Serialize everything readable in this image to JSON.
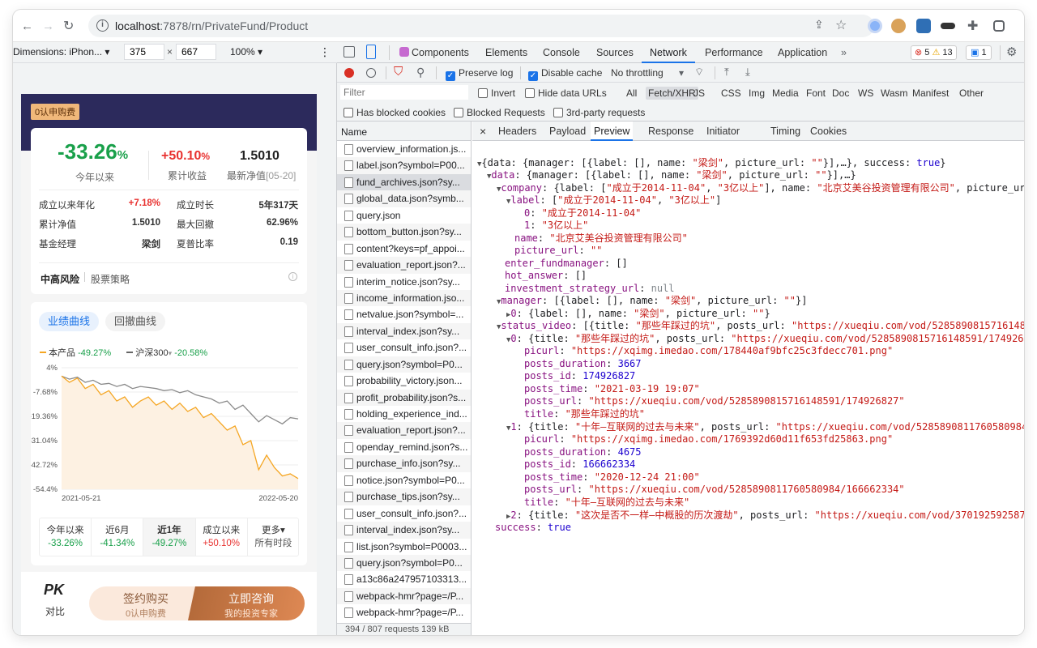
{
  "browser": {
    "url_host": "localhost",
    "url_rest": ":7878/rn/PrivateFund/Product"
  },
  "device_toolbar": {
    "dimensions_label": "Dimensions: iPhon...",
    "width": "375",
    "height": "667",
    "zoom": "100%"
  },
  "app": {
    "badge": "0认申购费",
    "summary": {
      "main_value": "-33.26",
      "main_unit": "%",
      "main_label": "今年以来",
      "cum_value": "+50.10",
      "cum_unit": "%",
      "cum_label": "累计收益",
      "nav_value": "1.5010",
      "nav_label": "最新净值",
      "nav_date": "[05-20]"
    },
    "stats": [
      {
        "label": "成立以来年化",
        "value": "+7.18%"
      },
      {
        "label": "成立时长",
        "value": "5年317天"
      },
      {
        "label": "累计净值",
        "value": "1.5010"
      },
      {
        "label": "最大回撤",
        "value": "62.96%"
      },
      {
        "label": "基金经理",
        "value": "梁剑"
      },
      {
        "label": "夏普比率",
        "value": "0.19"
      }
    ],
    "risk": "中高风险",
    "strategy": "股票策略",
    "chart_tabs": [
      "业绩曲线",
      "回撤曲线"
    ],
    "legend": {
      "product_name": "本产品",
      "product_value": "-49.27%",
      "index_name": "沪深300",
      "index_value": "-20.58%"
    },
    "periods": [
      {
        "name": "今年以来",
        "value": "-33.26%"
      },
      {
        "name": "近6月",
        "value": "-41.34%"
      },
      {
        "name": "近1年",
        "value": "-49.27%"
      },
      {
        "name": "成立以来",
        "value": "+50.10%"
      },
      {
        "name": "更多▾",
        "value": "所有时段"
      }
    ],
    "pk": {
      "title": "PK",
      "label": "对比"
    },
    "buy": {
      "title": "签约购买",
      "sub": "0认申购费"
    },
    "consult": {
      "title": "立即咨询",
      "sub": "我的投资专家"
    }
  },
  "chart_data": {
    "type": "line",
    "y_ticks": [
      "4%",
      "-7.68%",
      "-19.36%",
      "-31.04%",
      "-42.72%",
      "-54.4%"
    ],
    "ylim": [
      -54.4,
      4
    ],
    "x_ticks": [
      "2021-05-21",
      "2022-05-20"
    ],
    "series": [
      {
        "name": "本产品",
        "color": "#f5a623",
        "values": [
          0,
          -3,
          -1,
          -6,
          -4,
          -9,
          -7,
          -12,
          -10,
          -15,
          -12,
          -10,
          -14,
          -12,
          -16,
          -13,
          -17,
          -15,
          -20,
          -18,
          -22,
          -26,
          -24,
          -33,
          -31,
          -45,
          -38,
          -44,
          -48,
          -47,
          -49.27
        ]
      },
      {
        "name": "沪深300",
        "color": "#8a8a8a",
        "values": [
          0,
          -1.5,
          -0.5,
          -3,
          -2,
          -4,
          -3.5,
          -5,
          -4,
          -6,
          -5,
          -5.5,
          -6,
          -7,
          -6.5,
          -8,
          -7,
          -9,
          -10,
          -11,
          -13,
          -12,
          -16,
          -14,
          -18,
          -22,
          -19,
          -21,
          -23,
          -20,
          -20.58
        ]
      }
    ]
  },
  "devtools": {
    "top_tabs": [
      "Components",
      "Elements",
      "Console",
      "Sources",
      "Network",
      "Performance",
      "Application"
    ],
    "active_tab": "Network",
    "errors": "5",
    "warnings": "13",
    "infos": "1",
    "preserve_log": "Preserve log",
    "disable_cache": "Disable cache",
    "throttling": "No throttling",
    "filter_placeholder": "Filter",
    "invert": "Invert",
    "hide_data_urls": "Hide data URLs",
    "type_filters": [
      "All",
      "Fetch/XHR",
      "JS",
      "CSS",
      "Img",
      "Media",
      "Font",
      "Doc",
      "WS",
      "Wasm",
      "Manifest",
      "Other"
    ],
    "has_blocked": "Has blocked cookies",
    "blocked_requests": "Blocked Requests",
    "third_party": "3rd-party requests",
    "name_header": "Name",
    "requests": [
      "overview_information.js...",
      "label.json?symbol=P00...",
      "fund_archives.json?sy...",
      "global_data.json?symb...",
      "query.json",
      "bottom_button.json?sy...",
      "content?keys=pf_appoi...",
      "evaluation_report.json?...",
      "interim_notice.json?sy...",
      "income_information.jso...",
      "netvalue.json?symbol=...",
      "interval_index.json?sy...",
      "user_consult_info.json?...",
      "query.json?symbol=P0...",
      "probability_victory.json...",
      "profit_probability.json?s...",
      "holding_experience_ind...",
      "evaluation_report.json?...",
      "openday_remind.json?s...",
      "purchase_info.json?sy...",
      "notice.json?symbol=P0...",
      "purchase_tips.json?sy...",
      "user_consult_info.json?...",
      "interval_index.json?sy...",
      "list.json?symbol=P0003...",
      "query.json?symbol=P0...",
      "a13c86a247957103313...",
      "webpack-hmr?page=/P...",
      "webpack-hmr?page=/P..."
    ],
    "status_bar": "394 / 807 requests   139 kB",
    "preview_tabs": [
      "Headers",
      "Payload",
      "Preview",
      "Response",
      "Initiator",
      "Timing",
      "Cookies"
    ],
    "active_preview": "Preview"
  }
}
